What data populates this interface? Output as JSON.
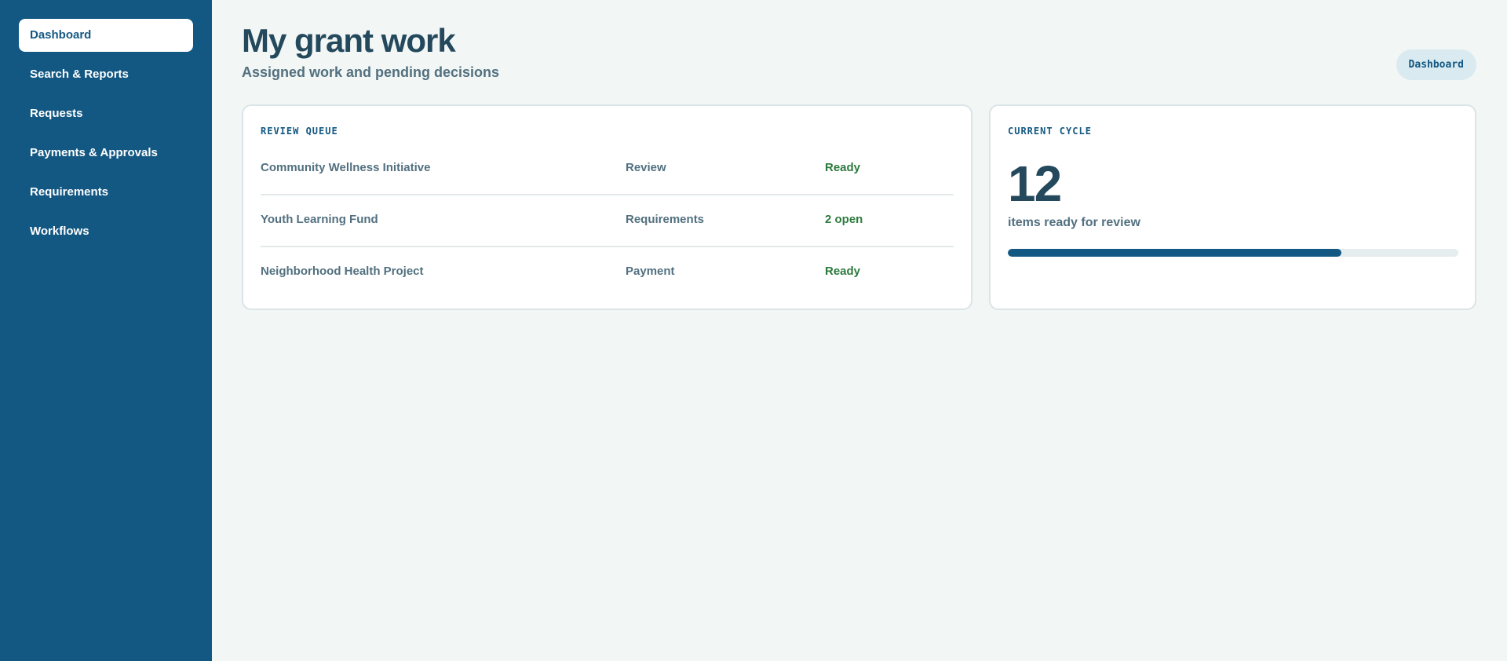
{
  "sidebar": {
    "items": [
      {
        "label": "Dashboard",
        "active": true
      },
      {
        "label": "Search & Reports",
        "active": false
      },
      {
        "label": "Requests",
        "active": false
      },
      {
        "label": "Payments & Approvals",
        "active": false
      },
      {
        "label": "Requirements",
        "active": false
      },
      {
        "label": "Workflows",
        "active": false
      }
    ]
  },
  "header": {
    "title": "My grant work",
    "subtitle": "Assigned work and pending decisions",
    "breadcrumb": "Dashboard"
  },
  "review_queue": {
    "label": "REVIEW QUEUE",
    "rows": [
      {
        "name": "Community Wellness Initiative",
        "stage": "Review",
        "status": "Ready"
      },
      {
        "name": "Youth Learning Fund",
        "stage": "Requirements",
        "status": "2 open"
      },
      {
        "name": "Neighborhood Health Project",
        "stage": "Payment",
        "status": "Ready"
      }
    ]
  },
  "current_cycle": {
    "label": "CURRENT CYCLE",
    "count": "12",
    "description": "items ready for review",
    "progress_fraction": 0.74
  },
  "colors": {
    "sidebar_bg": "#135883",
    "accent": "#135883",
    "status_green": "#2c7a3c",
    "page_bg": "#f2f6f5"
  }
}
